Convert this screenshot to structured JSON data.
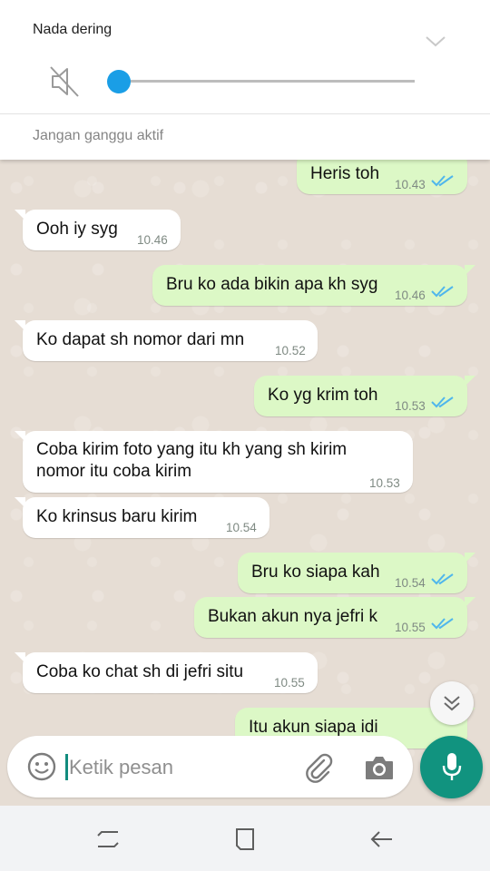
{
  "volume_panel": {
    "title": "Nada dering",
    "dnd_status": "Jangan ganggu aktif",
    "level": 0,
    "accent_color": "#1a9ee6"
  },
  "messages": [
    {
      "direction": "out",
      "text": "Heris toh",
      "time": "10.43",
      "status": "read"
    },
    {
      "direction": "in",
      "text": "Ooh iy syg",
      "time": "10.46"
    },
    {
      "direction": "out",
      "text": "Bru ko ada bikin apa kh syg",
      "time": "10.46",
      "status": "read"
    },
    {
      "direction": "in",
      "text": "Ko dapat sh nomor dari mn",
      "time": "10.52"
    },
    {
      "direction": "out",
      "text": "Ko yg krim toh",
      "time": "10.53",
      "status": "read"
    },
    {
      "direction": "in",
      "text_lines": [
        "Coba kirim foto yang itu kh yang sh kirim",
        "nomor itu coba kirim"
      ],
      "time": "10.53"
    },
    {
      "direction": "in",
      "text": "Ko krinsus baru kirim",
      "time": "10.54"
    },
    {
      "direction": "out",
      "text": "Bru ko siapa kah",
      "time": "10.54",
      "status": "read"
    },
    {
      "direction": "out",
      "text": "Bukan akun nya jefri k",
      "time": "10.55",
      "status": "read"
    },
    {
      "direction": "in",
      "text": "Coba ko chat sh di jefri situ",
      "time": "10.55"
    },
    {
      "direction": "out",
      "text": "Itu akun siapa idi",
      "time": "",
      "status": "read"
    }
  ],
  "composer": {
    "placeholder": "Ketik pesan",
    "icons": [
      "emoji-icon",
      "attach-icon",
      "camera-icon",
      "mic-icon"
    ]
  },
  "nav_bar": {
    "icons": [
      "recent-apps-icon",
      "home-icon",
      "back-icon"
    ]
  },
  "colors": {
    "outgoing_bubble": "#dcf8c6",
    "incoming_bubble": "#ffffff",
    "read_ticks": "#4fb6ec",
    "mic_button": "#11937f",
    "chat_background": "#e6ddd4"
  }
}
